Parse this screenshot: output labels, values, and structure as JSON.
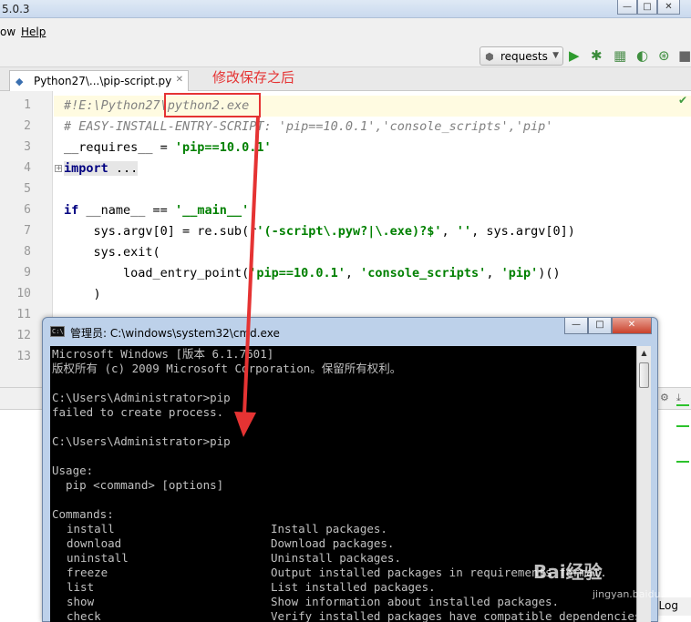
{
  "ide": {
    "title_fragment": "5.0.3",
    "menu": [
      "ow",
      "Help"
    ],
    "run_config": "requests",
    "tab_label": "Python27\\...\\pip-script.py",
    "annotation": "修改保存之后",
    "line_numbers": [
      "1",
      "2",
      "3",
      "4",
      "5",
      "6",
      "7",
      "8",
      "9",
      "10",
      "11",
      "12",
      "13"
    ],
    "event_log": "t Log"
  },
  "code": {
    "l1_a": "#!E:\\Python27\\",
    "l1_b": "python2.exe",
    "l2": "# EASY-INSTALL-ENTRY-SCRIPT: 'pip==10.0.1','console_scripts','pip'",
    "l3_a": "__requires__ = ",
    "l3_b": "'pip==10.0.1'",
    "l4_a": "import",
    "l4_b": " ...",
    "l8_a": "if",
    "l8_b": " __name__ == ",
    "l8_c": "'__main__'",
    "l8_d": ":",
    "l9_a": "    sys.argv[0] = re.sub(r",
    "l9_b": "'(-script\\.pyw?|\\.exe)?$'",
    "l9_c": ", ",
    "l9_d": "''",
    "l9_e": ", sys.argv[0])",
    "l10": "    sys.exit(",
    "l11_a": "        load_entry_point(",
    "l11_b": "'pip==10.0.1'",
    "l11_c": ", ",
    "l11_d": "'console_scripts'",
    "l11_e": ", ",
    "l11_f": "'pip'",
    "l11_g": ")()",
    "l12": "    )"
  },
  "cmd": {
    "title": "管理员: C:\\windows\\system32\\cmd.exe",
    "icon_text": "C:\\",
    "lines": [
      "Microsoft Windows [版本 6.1.7601]",
      "版权所有 (c) 2009 Microsoft Corporation。保留所有权利。",
      "",
      "C:\\Users\\Administrator>pip",
      "failed to create process.",
      "",
      "C:\\Users\\Administrator>pip",
      "",
      "Usage:",
      "  pip <command> [options]",
      "",
      "Commands:"
    ],
    "commands": [
      {
        "name": "install",
        "desc": "Install packages."
      },
      {
        "name": "download",
        "desc": "Download packages."
      },
      {
        "name": "uninstall",
        "desc": "Uninstall packages."
      },
      {
        "name": "freeze",
        "desc": "Output installed packages in requirements format."
      },
      {
        "name": "list",
        "desc": "List installed packages."
      },
      {
        "name": "show",
        "desc": "Show information about installed packages."
      },
      {
        "name": "check",
        "desc": "Verify installed packages have compatible dependencies."
      }
    ]
  },
  "colors": {
    "annotation_red": "#e53333",
    "string_green": "#008000",
    "keyword_navy": "#000080",
    "comment_gray": "#808080"
  },
  "watermark": {
    "main": "Bai经验",
    "sub": "jingyan.baidu.com"
  }
}
